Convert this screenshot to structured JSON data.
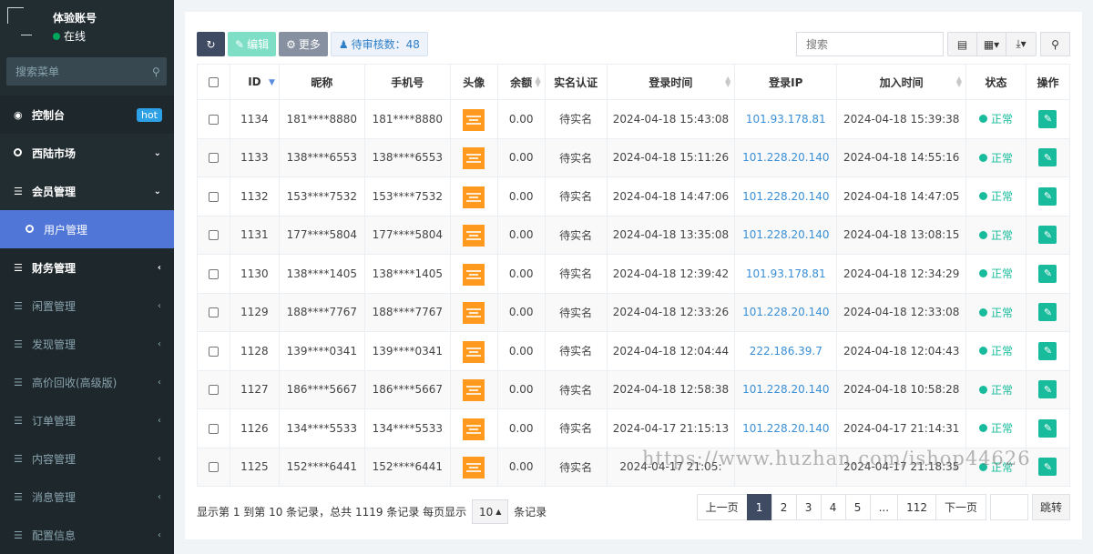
{
  "sidebar": {
    "user_name": "体验账号",
    "user_status": "在线",
    "search_placeholder": "搜索菜单",
    "items": [
      {
        "label": "控制台",
        "badge": "hot",
        "icon": "dashboard-icon"
      },
      {
        "label": "西陆市场",
        "icon": "circle-icon"
      },
      {
        "label": "会员管理",
        "icon": "list-icon"
      },
      {
        "label": "用户管理",
        "icon": "circle-icon"
      },
      {
        "label": "财务管理",
        "icon": "list-icon"
      },
      {
        "label": "闲置管理",
        "icon": "list-icon"
      },
      {
        "label": "发现管理",
        "icon": "list-icon"
      },
      {
        "label": "高价回收(高级版)",
        "icon": "list-icon"
      },
      {
        "label": "订单管理",
        "icon": "list-icon"
      },
      {
        "label": "内容管理",
        "icon": "list-icon"
      },
      {
        "label": "消息管理",
        "icon": "list-icon"
      },
      {
        "label": "配置信息",
        "icon": "list-icon"
      }
    ]
  },
  "toolbar": {
    "edit_label": "编辑",
    "more_label": "更多",
    "pending_label": "待审核数：48",
    "search_placeholder": "搜索"
  },
  "table": {
    "headers": [
      "ID",
      "昵称",
      "手机号",
      "头像",
      "余额",
      "实名认证",
      "登录时间",
      "登录IP",
      "加入时间",
      "状态",
      "操作"
    ],
    "rows": [
      {
        "id": "1134",
        "nick": "181****8880",
        "phone": "181****8880",
        "balance": "0.00",
        "auth": "待实名",
        "login_time": "2024-04-18 15:43:08",
        "ip": "101.93.178.81",
        "join_time": "2024-04-18 15:39:38",
        "status": "正常"
      },
      {
        "id": "1133",
        "nick": "138****6553",
        "phone": "138****6553",
        "balance": "0.00",
        "auth": "待实名",
        "login_time": "2024-04-18 15:11:26",
        "ip": "101.228.20.140",
        "join_time": "2024-04-18 14:55:16",
        "status": "正常"
      },
      {
        "id": "1132",
        "nick": "153****7532",
        "phone": "153****7532",
        "balance": "0.00",
        "auth": "待实名",
        "login_time": "2024-04-18 14:47:06",
        "ip": "101.228.20.140",
        "join_time": "2024-04-18 14:47:05",
        "status": "正常"
      },
      {
        "id": "1131",
        "nick": "177****5804",
        "phone": "177****5804",
        "balance": "0.00",
        "auth": "待实名",
        "login_time": "2024-04-18 13:35:08",
        "ip": "101.228.20.140",
        "join_time": "2024-04-18 13:08:15",
        "status": "正常"
      },
      {
        "id": "1130",
        "nick": "138****1405",
        "phone": "138****1405",
        "balance": "0.00",
        "auth": "待实名",
        "login_time": "2024-04-18 12:39:42",
        "ip": "101.93.178.81",
        "join_time": "2024-04-18 12:34:29",
        "status": "正常"
      },
      {
        "id": "1129",
        "nick": "188****7767",
        "phone": "188****7767",
        "balance": "0.00",
        "auth": "待实名",
        "login_time": "2024-04-18 12:33:26",
        "ip": "101.228.20.140",
        "join_time": "2024-04-18 12:33:08",
        "status": "正常"
      },
      {
        "id": "1128",
        "nick": "139****0341",
        "phone": "139****0341",
        "balance": "0.00",
        "auth": "待实名",
        "login_time": "2024-04-18 12:04:44",
        "ip": "222.186.39.7",
        "join_time": "2024-04-18 12:04:43",
        "status": "正常"
      },
      {
        "id": "1127",
        "nick": "186****5667",
        "phone": "186****5667",
        "balance": "0.00",
        "auth": "待实名",
        "login_time": "2024-04-18 12:58:38",
        "ip": "101.228.20.140",
        "join_time": "2024-04-18 10:58:28",
        "status": "正常"
      },
      {
        "id": "1126",
        "nick": "134****5533",
        "phone": "134****5533",
        "balance": "0.00",
        "auth": "待实名",
        "login_time": "2024-04-17 21:15:13",
        "ip": "101.228.20.140",
        "join_time": "2024-04-17 21:14:31",
        "status": "正常"
      },
      {
        "id": "1125",
        "nick": "152****6441",
        "phone": "152****6441",
        "balance": "0.00",
        "auth": "待实名",
        "login_time": "2024-04-17 21:05:",
        "ip": "",
        "join_time": "2024-04-17 21:18:35",
        "status": "正常"
      }
    ]
  },
  "footer": {
    "summary": "显示第 1 到第 10 条记录，总共 1119 条记录 每页显示",
    "page_size": "10",
    "suffix": "条记录"
  },
  "pager": {
    "prev": "上一页",
    "pages": [
      "1",
      "2",
      "3",
      "4",
      "5",
      "...",
      "112"
    ],
    "next": "下一页",
    "go": "跳转"
  },
  "watermark": "https://www.huzhan.com/ishop44626",
  "colors": {
    "accent": "#5076d8",
    "success": "#18bc9c",
    "sidebar": "#222d32",
    "ip": "#3a8fd6"
  }
}
